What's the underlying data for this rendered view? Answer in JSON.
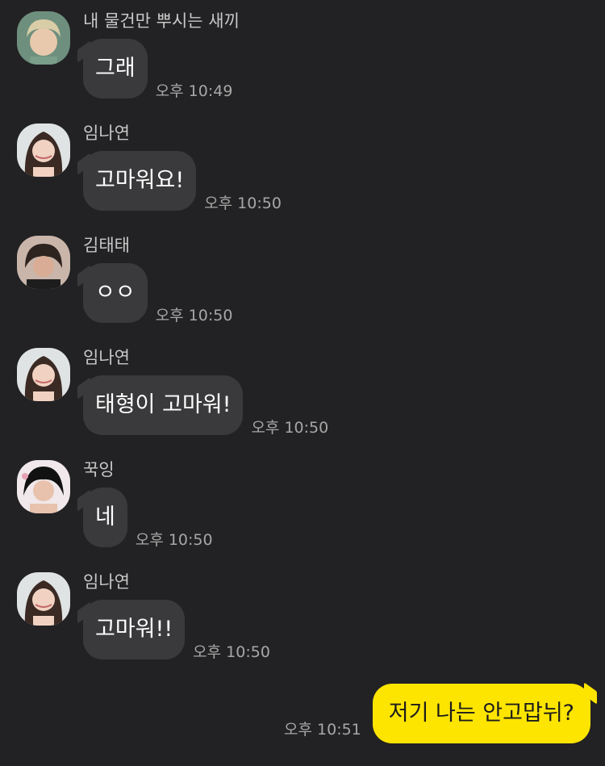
{
  "messages": [
    {
      "sender": "내 물건만 뿌시는 새끼",
      "text": "그래",
      "time": "오후 10:49",
      "avatar": "avatar-boy-light-hair"
    },
    {
      "sender": "임나연",
      "text": "고마워요!",
      "time": "오후 10:50",
      "avatar": "avatar-girl"
    },
    {
      "sender": "김태태",
      "text": "ㅇㅇ",
      "time": "오후 10:50",
      "avatar": "avatar-boy-dark"
    },
    {
      "sender": "임나연",
      "text": "태형이 고마워!",
      "time": "오후 10:50",
      "avatar": "avatar-girl"
    },
    {
      "sender": "꾹잉",
      "text": "네",
      "time": "오후 10:50",
      "avatar": "avatar-boy-black-hair"
    },
    {
      "sender": "임나연",
      "text": "고마워!!",
      "time": "오후 10:50",
      "avatar": "avatar-girl"
    }
  ],
  "my_message": {
    "text": "저기 나는 안고맙뉘?",
    "time": "오후 10:51"
  },
  "colors": {
    "background": "#222224",
    "incoming_bubble": "#3a3a3c",
    "outgoing_bubble": "#fee500"
  }
}
